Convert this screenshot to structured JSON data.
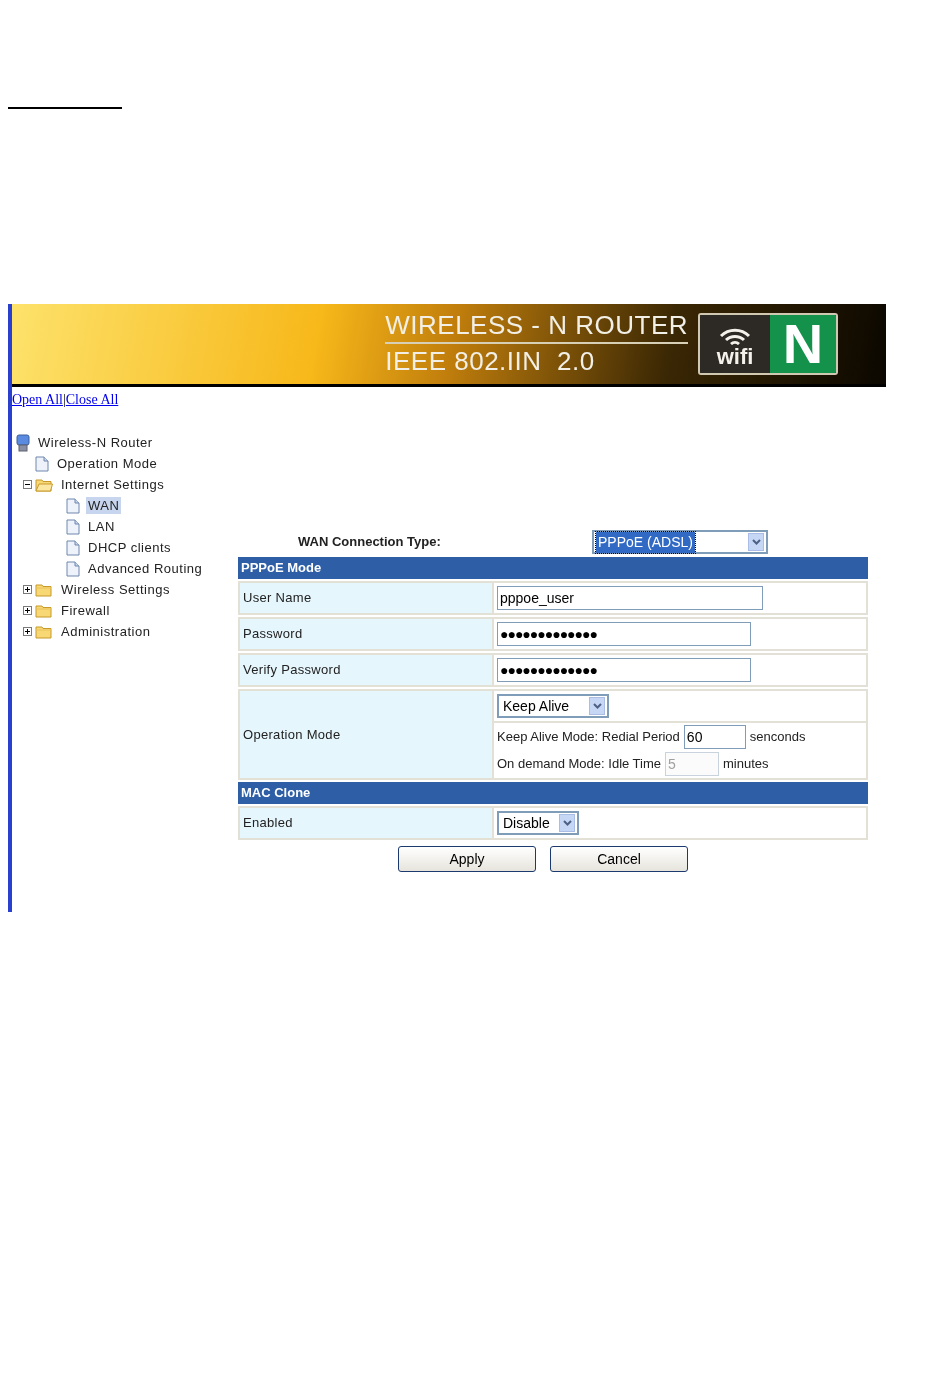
{
  "banner": {
    "title": "WIRELESS - N ROUTER",
    "subtitle": "IEEE 802.IIN  2.0",
    "logo_word": "wifi",
    "logo_letter": "N"
  },
  "tree_links": {
    "items": [
      "Open All",
      "Close All"
    ],
    "separator": "|"
  },
  "tree": {
    "kind": "root",
    "label": "Wireless-N Router",
    "selected": false,
    "children": [
      {
        "kind": "page",
        "label": "Operation Mode",
        "selected": false
      },
      {
        "kind": "folder",
        "label": "Internet Settings",
        "expanded": true,
        "selected": false,
        "children": [
          {
            "kind": "page",
            "label": "WAN",
            "selected": true
          },
          {
            "kind": "page",
            "label": "LAN",
            "selected": false
          },
          {
            "kind": "page",
            "label": "DHCP clients",
            "selected": false
          },
          {
            "kind": "page",
            "label": "Advanced Routing",
            "selected": false
          }
        ]
      },
      {
        "kind": "folder",
        "label": "Wireless Settings",
        "expanded": false,
        "selected": false
      },
      {
        "kind": "folder",
        "label": "Firewall",
        "expanded": false,
        "selected": false
      },
      {
        "kind": "folder",
        "label": "Administration",
        "expanded": false,
        "selected": false
      }
    ]
  },
  "wan_connection_type": {
    "label": "WAN Connection Type:",
    "value": "PPPoE (ADSL)"
  },
  "sections": [
    {
      "title": "PPPoE Mode",
      "rows": [
        {
          "kind": "text",
          "label": "User Name",
          "value": "pppoe_user"
        },
        {
          "kind": "password",
          "label": "Password",
          "value": "●●●●●●●●●●●●●"
        },
        {
          "kind": "password",
          "label": "Verify Password",
          "value": "●●●●●●●●●●●●●"
        },
        {
          "kind": "mode",
          "label": "Operation Mode",
          "value": "Keep Alive",
          "lines": [
            {
              "text": "Keep Alive Mode: Redial Period",
              "value": "60",
              "unit": "senconds",
              "disabled": false
            },
            {
              "text": "On demand Mode: Idle Time",
              "value": "5",
              "unit": "minutes",
              "disabled": true
            }
          ]
        }
      ]
    },
    {
      "title": "MAC Clone",
      "rows": [
        {
          "kind": "select",
          "label": "Enabled",
          "value": "Disable"
        }
      ]
    }
  ],
  "buttons": [
    "Apply",
    "Cancel"
  ]
}
